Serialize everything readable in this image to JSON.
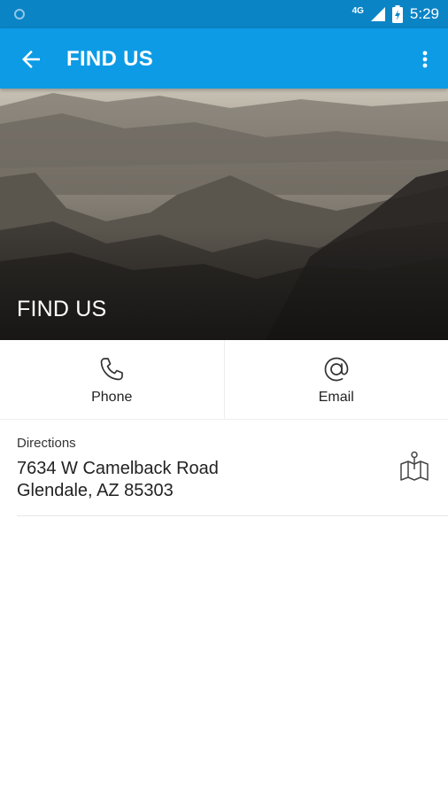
{
  "status_bar": {
    "network": "4G",
    "time": "5:29"
  },
  "app_bar": {
    "title": "FIND US",
    "back_icon": "arrow-left-icon",
    "menu_icon": "more-vert-icon"
  },
  "hero": {
    "title": "FIND US"
  },
  "actions": [
    {
      "label": "Phone",
      "icon": "phone-icon"
    },
    {
      "label": "Email",
      "icon": "at-sign-icon"
    }
  ],
  "directions": {
    "label": "Directions",
    "address_line1": "7634 W Camelback Road",
    "address_line2": "Glendale, AZ 85303",
    "icon": "map-pin-icon"
  },
  "colors": {
    "status_bar": "#0b84c6",
    "app_bar": "#0d9be5",
    "text": "#222222"
  }
}
